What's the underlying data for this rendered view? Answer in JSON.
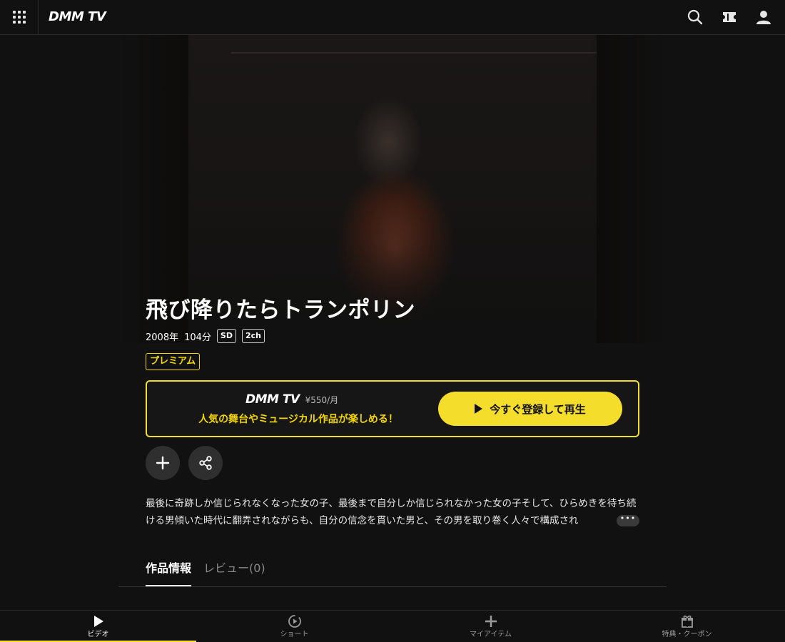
{
  "header": {
    "logo": "DMM TV",
    "menu_icon": "grid-menu-icon",
    "icons": [
      "search-icon",
      "ticket-icon",
      "user-icon"
    ]
  },
  "title": "飛び降りたらトランポリン",
  "meta": {
    "year": "2008年",
    "duration": "104分",
    "quality": "SD",
    "audio": "2ch"
  },
  "premium_badge": "プレミアム",
  "promo": {
    "logo": "DMM TV",
    "price": "¥550/月",
    "tagline": "人気の舞台やミュージカル作品が楽しめる！",
    "button_label": "今すぐ登録して再生"
  },
  "actions": [
    "add-to-list",
    "share"
  ],
  "description": "最後に奇跡しか信じられなくなった女の子、最後まで自分しか信じられなかった女の子そして、ひらめきを待ち続ける男傾いた時代に翻弄されながらも、自分の信念を貫いた男と、その男を取り巻く人々で構成され",
  "more_label": "•••",
  "tabs": [
    {
      "label": "作品情報",
      "active": true
    },
    {
      "label": "レビュー(0)",
      "active": false
    }
  ],
  "bottom_nav": [
    {
      "label": "ビデオ",
      "icon": "play-icon",
      "active": true
    },
    {
      "label": "ショート",
      "icon": "short-play-icon",
      "active": false
    },
    {
      "label": "マイアイテム",
      "icon": "plus-icon",
      "active": false
    },
    {
      "label": "特典・クーポン",
      "icon": "gift-icon",
      "active": false
    }
  ],
  "colors": {
    "accent": "#f5dd2b",
    "background": "#111111"
  }
}
